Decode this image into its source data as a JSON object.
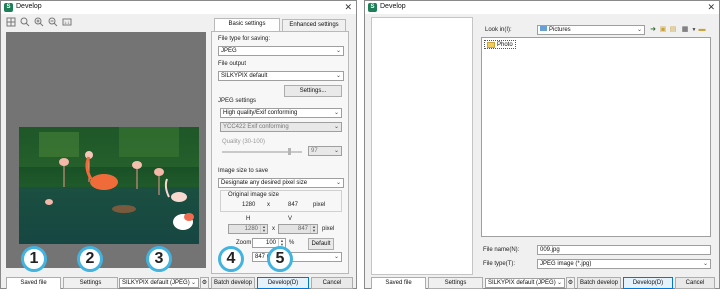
{
  "left_window": {
    "title": "Develop",
    "tabs": {
      "basic": "Basic settings",
      "enhanced": "Enhanced settings"
    },
    "file_type": {
      "label": "File type for saving:",
      "value": "JPEG"
    },
    "file_output": {
      "label": "File output",
      "value": "SILKYPIX default",
      "settings_button": "Settings..."
    },
    "jpeg_settings": {
      "label": "JPEG settings",
      "quality_mode": "High quality/Exif conforming",
      "chroma": "YCC422 Exif conforming",
      "quality_label": "Quality (30-100)",
      "quality_value": "97",
      "quality_level": 0.97
    },
    "image_size": {
      "label": "Image size to save",
      "mode": "Designate any desired pixel size",
      "original_label": "Original image size",
      "orig_w": "1280",
      "x": "x",
      "orig_h": "847",
      "unit": "pixel",
      "h_label": "H",
      "v_label": "V",
      "h_value": "1280",
      "v_value": "847",
      "zoom_label": "Zoom",
      "zoom_value": "100",
      "percent": "%",
      "default_button": "Default",
      "preset_partial": "847 (100"
    },
    "bottom": {
      "saved_file": "Saved file",
      "settings": "Settings",
      "preset": "SILKYPIX default (JPEG)",
      "batch": "Batch develop",
      "develop": "Develop(D)",
      "cancel": "Cancel"
    },
    "callouts": [
      "1",
      "2",
      "3",
      "4",
      "5"
    ],
    "toolbar_icons": [
      "fit-icon",
      "zoom-icon",
      "zoom-in-icon",
      "zoom-out-icon",
      "actual-size-icon"
    ],
    "close": "✕"
  },
  "right_window": {
    "title": "Develop",
    "look_in_label": "Look in(I):",
    "look_in_value": "Pictures",
    "folder_item": "Photo",
    "file_name_label": "File name(N):",
    "file_name_value": "009.jpg",
    "file_type_label": "File type(T):",
    "file_type_value": "JPEG image (*.jpg)",
    "bottom": {
      "saved_file": "Saved file",
      "settings": "Settings",
      "preset": "SILKYPIX default (JPEG)",
      "batch": "Batch develop",
      "develop": "Develop(D)",
      "cancel": "Cancel"
    },
    "close": "✕"
  }
}
